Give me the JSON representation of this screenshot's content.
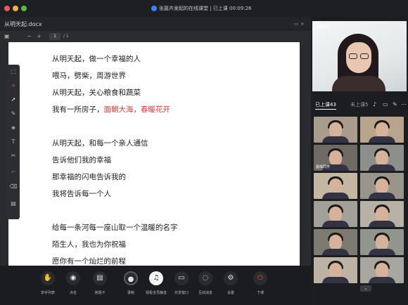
{
  "window": {
    "title": "张嘉卉发起的在线课堂 | 已上课 00:09:26"
  },
  "document": {
    "file_name": "从明天起.docx",
    "page_current": "1",
    "page_total": "/ 1",
    "lines": [
      "从明天起，做一个幸福的人",
      "喂马，劈柴，周游世界",
      "从明天起，关心粮食和蔬菜",
      "我有一所房子，",
      "",
      "从明天起，和每一个亲人通信",
      "告诉他们我的幸福",
      "那幸福的闪电告诉我的",
      "我将告诉每一个人",
      "",
      "给每一条河每一座山取一个温暖的名字",
      "陌生人，我也为你祝福",
      "愿你有一个灿烂的前程"
    ],
    "highlight_line_index": 3,
    "highlight_text": "面朝大海，春暖花开",
    "highlight_color": "#d6393a"
  },
  "teacher": {
    "name": "张嘉卉"
  },
  "roster": {
    "tab_in_class": "已上课43",
    "tab_not_in_class": "未上课5",
    "students": [
      {
        "name": "",
        "bg": "#a89c8c"
      },
      {
        "name": "",
        "bg": "#b9a48d"
      },
      {
        "name": "嘉琪同学",
        "bg": "#6f6a63"
      },
      {
        "name": "",
        "bg": "#8c8f8a"
      },
      {
        "name": "",
        "bg": "#c4b7a2"
      },
      {
        "name": "",
        "bg": "#9a958b"
      },
      {
        "name": "",
        "bg": "#a3a09a"
      },
      {
        "name": "",
        "bg": "#b8b2a6"
      },
      {
        "name": "",
        "bg": "#7d7a72"
      },
      {
        "name": "",
        "bg": "#91958d"
      },
      {
        "name": "",
        "bg": "#bcb3a5"
      },
      {
        "name": "",
        "bg": "#a7a7a0"
      }
    ]
  },
  "toolbar": {
    "items": [
      {
        "label": "举手列表",
        "icon": "hand-icon"
      },
      {
        "label": "点名",
        "icon": "rollcall-icon"
      },
      {
        "label": "答题卡",
        "icon": "answer-card-icon"
      },
      {
        "label": "录制",
        "icon": "record-icon"
      },
      {
        "label": "观看全员静音",
        "icon": "mute-all-icon"
      },
      {
        "label": "共享窗口",
        "icon": "share-window-icon"
      },
      {
        "label": "互动消息",
        "icon": "chat-icon"
      },
      {
        "label": "设置",
        "icon": "gear-icon"
      },
      {
        "label": "下课",
        "icon": "power-icon"
      }
    ]
  }
}
